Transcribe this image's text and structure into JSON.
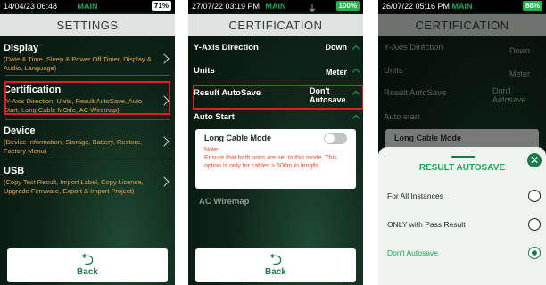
{
  "screen1": {
    "status": {
      "time": "14/04/23 06:48",
      "mode": "MAIN",
      "battery": "71%"
    },
    "title": "SETTINGS",
    "items": [
      {
        "title": "Display",
        "sub": "(Date & Time, Sleep & Power Off Timer, Display & Audio, Language)"
      },
      {
        "title": "Certification",
        "sub": "(Y-Axis Direction, Units, Result AutoSave, Auto Start, Long Cable MOde, AC Wiremap)"
      },
      {
        "title": "Device",
        "sub": "(Device Information, Storage, Battery, Restore, Factory Menu)"
      },
      {
        "title": "USB",
        "sub": "(Copy Test Result, Import Label, Copy License, Upgrade Firmware, Export & Import Project)"
      }
    ],
    "back_label": "Back"
  },
  "screen2": {
    "status": {
      "time": "27/07/22 03:19 PM",
      "mode": "MAIN",
      "battery": "100%"
    },
    "title": "CERTIFICATION",
    "rows": [
      {
        "label": "Y-Axis Direction",
        "value": "Down"
      },
      {
        "label": "Units",
        "value": "Meter"
      },
      {
        "label": "Result AutoSave",
        "value": "Don't Autosave"
      },
      {
        "label": "Auto Start",
        "value": ""
      }
    ],
    "card": {
      "title": "Long Cable Mode",
      "note_title": "Note:",
      "note": "Ensure that both units are set to this mode. This option is only for cables > 500m in length"
    },
    "ac_wiremap": "AC Wiremap",
    "back_label": "Back"
  },
  "screen3": {
    "status": {
      "time": "26/07/22 05:16 PM",
      "mode": "MAIN",
      "battery": "86%"
    },
    "title": "CERTIFICATION",
    "rows": [
      {
        "label": "Y-Axis Direction",
        "value": "Down"
      },
      {
        "label": "Units",
        "value": "Meter"
      },
      {
        "label": "Result AutoSave",
        "value": "Don't Autosave"
      },
      {
        "label": "Auto start",
        "value": ""
      }
    ],
    "card_title": "Long Cable Mode",
    "sheet": {
      "title": "RESULT AUTOSAVE",
      "options": [
        {
          "label": "For All Instances",
          "selected": false
        },
        {
          "label": "ONLY with Pass Result",
          "selected": false
        },
        {
          "label": "Don't Autosave",
          "selected": true
        }
      ]
    }
  },
  "colors": {
    "accent": "#1ea65a",
    "highlight": "#e02020",
    "note": "#e05030",
    "sub_text": "#e8a34a"
  },
  "icons": [
    "chevron-right-icon",
    "chevron-up-icon",
    "back-arrow-icon",
    "plug-icon",
    "close-icon"
  ]
}
